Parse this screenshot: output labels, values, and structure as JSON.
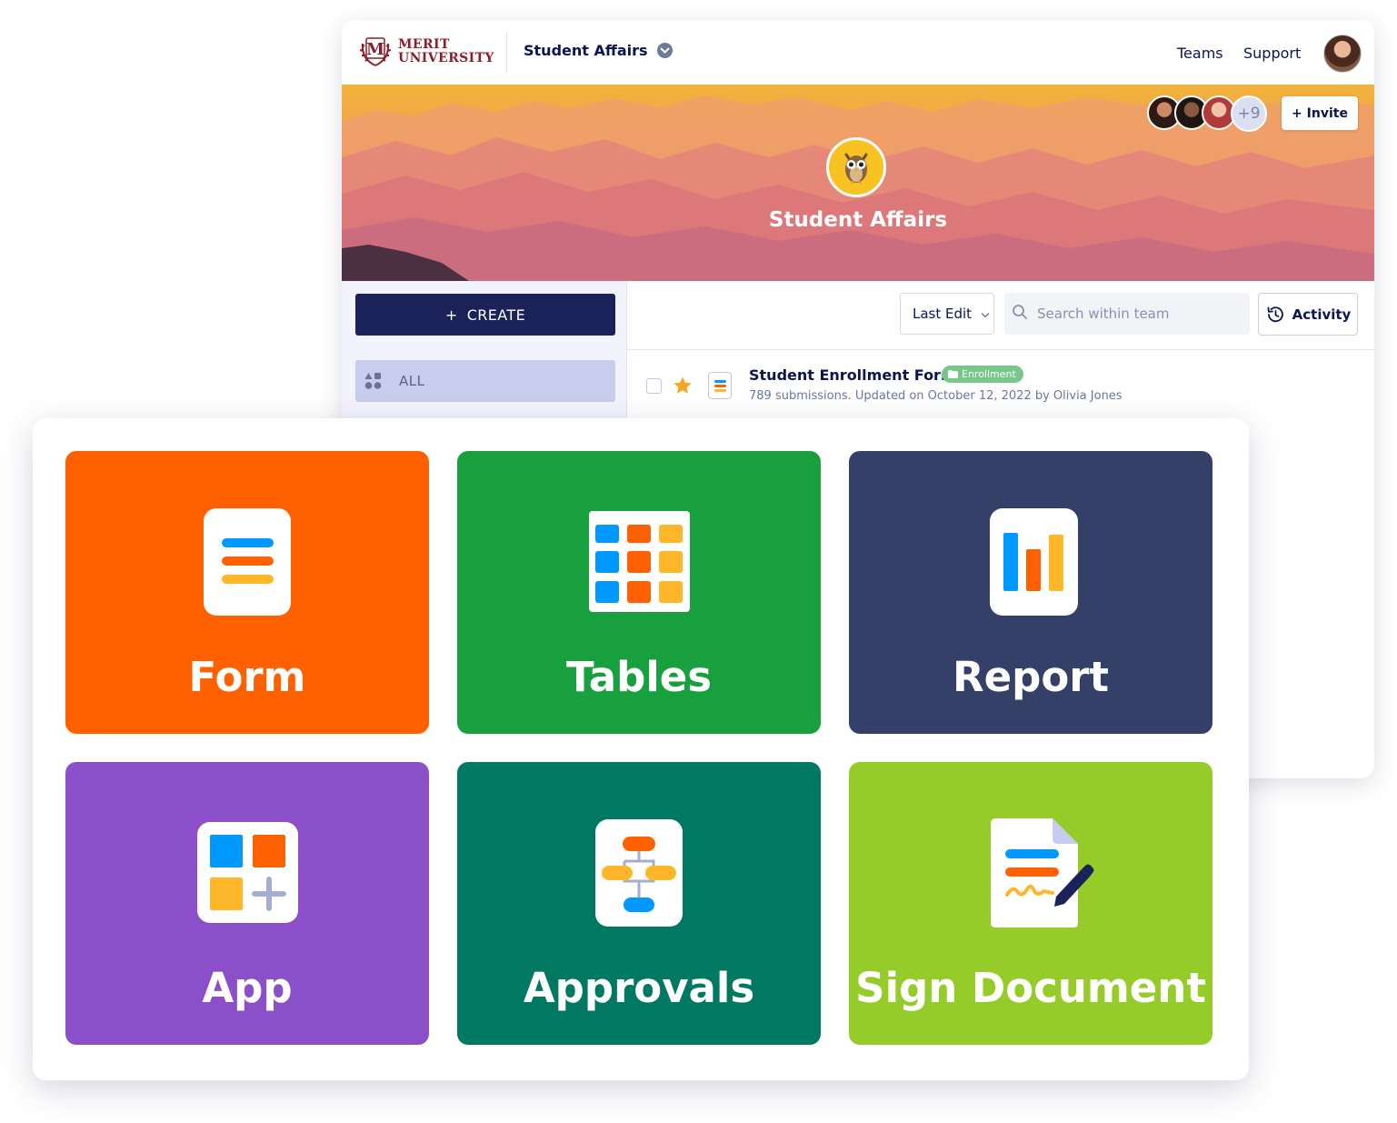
{
  "header": {
    "logo_line1": "MERIT",
    "logo_line2": "UNIVERSITY",
    "team_name": "Student Affairs",
    "nav": [
      "Teams",
      "Support"
    ]
  },
  "banner": {
    "title": "Student Affairs",
    "members_more": "+9",
    "invite_label": "+ Invite"
  },
  "sidebar": {
    "create_label": "CREATE",
    "items": [
      {
        "label": "ALL"
      }
    ]
  },
  "toolbar": {
    "sort_label": "Last Edit",
    "search_placeholder": "Search within team",
    "activity_label": "Activity"
  },
  "assets": [
    {
      "title": "Student Enrollment Form",
      "tag": "Enrollment",
      "meta": "789 submissions. Updated on October 12, 2022 by Olivia Jones"
    }
  ],
  "create_options": [
    {
      "label": "Form",
      "color": "#ff6100"
    },
    {
      "label": "Tables",
      "color": "#189f3e"
    },
    {
      "label": "Report",
      "color": "#344067"
    },
    {
      "label": "App",
      "color": "#8b50c9"
    },
    {
      "label": "Approvals",
      "color": "#007862"
    },
    {
      "label": "Sign Document",
      "color": "#96cc2a"
    }
  ],
  "colors": {
    "navy": "#0a1551",
    "create_button": "#1b2159",
    "sidebar_active": "#c8cdee",
    "tag_green": "#78c78a",
    "star": "#f5a623"
  }
}
